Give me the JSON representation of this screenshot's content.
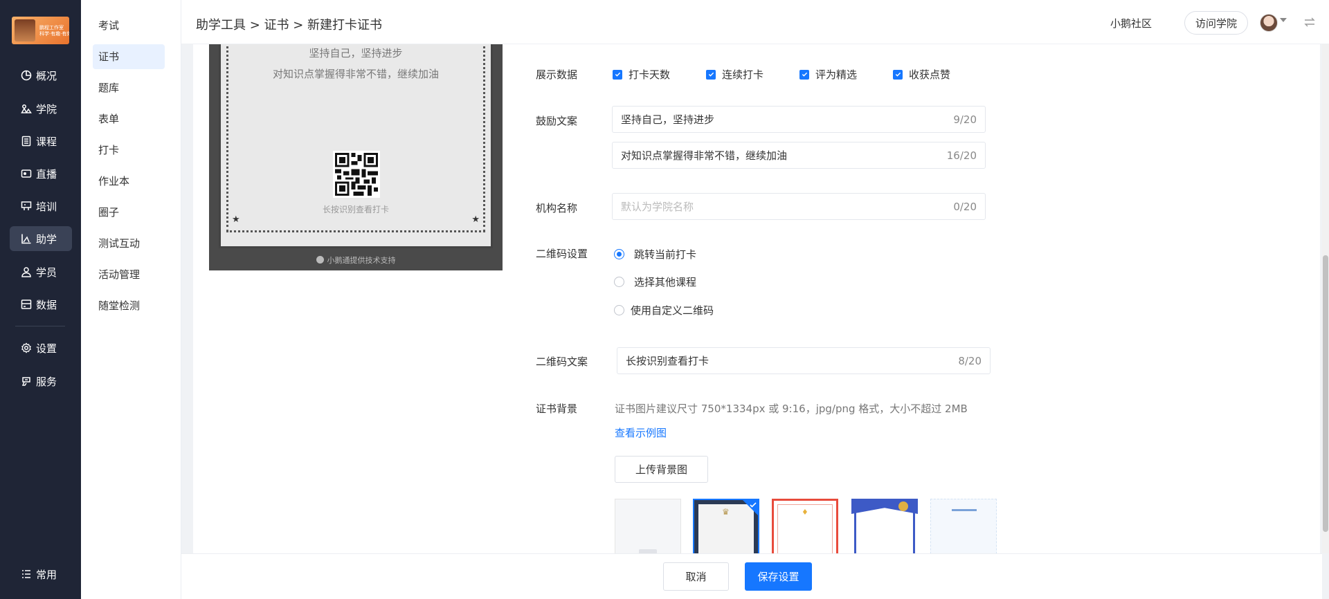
{
  "app": {
    "logo_text_line1": "鹏程工作室",
    "logo_text_line2": "科学·有趣·有效的成长"
  },
  "main_nav": [
    {
      "label": "概况",
      "icon": "pie-chart-icon"
    },
    {
      "label": "学院",
      "icon": "academy-icon"
    },
    {
      "label": "课程",
      "icon": "course-icon"
    },
    {
      "label": "直播",
      "icon": "live-icon"
    },
    {
      "label": "培训",
      "icon": "training-icon"
    },
    {
      "label": "助学",
      "icon": "study-aid-icon",
      "active": true
    },
    {
      "label": "学员",
      "icon": "user-icon"
    },
    {
      "label": "数据",
      "icon": "data-icon"
    },
    {
      "label": "设置",
      "icon": "gear-icon"
    },
    {
      "label": "服务",
      "icon": "service-icon"
    },
    {
      "label": "常用",
      "icon": "list-icon"
    }
  ],
  "sub_nav": [
    {
      "label": "考试"
    },
    {
      "label": "证书",
      "active": true
    },
    {
      "label": "题库"
    },
    {
      "label": "表单"
    },
    {
      "label": "打卡"
    },
    {
      "label": "作业本"
    },
    {
      "label": "圈子"
    },
    {
      "label": "测试互动"
    },
    {
      "label": "活动管理"
    },
    {
      "label": "随堂检测"
    }
  ],
  "header": {
    "breadcrumb": "助学工具 > 证书 > 新建打卡证书",
    "community": "小鹅社区",
    "visit_button": "访问学院"
  },
  "preview": {
    "line1": "坚持自己，坚持进步",
    "line2": "对知识点掌握得非常不错，继续加油",
    "qr_text": "长按识别查看打卡",
    "footer": "小鹅通提供技术支持"
  },
  "form": {
    "display_label": "展示数据",
    "display_options": [
      "打卡天数",
      "连续打卡",
      "评为精选",
      "收获点赞"
    ],
    "encourage_label": "鼓励文案",
    "encourage_1": {
      "value": "坚持自己，坚持进步",
      "count": "9/20"
    },
    "encourage_2": {
      "value": "对知识点掌握得非常不错，继续加油",
      "count": "16/20"
    },
    "org_label": "机构名称",
    "org": {
      "placeholder": "默认为学院名称",
      "count": "0/20"
    },
    "qr_label": "二维码设置",
    "qr_options": [
      {
        "label": "跳转当前打卡",
        "selected": true
      },
      {
        "label": "选择其他课程",
        "selected": false
      },
      {
        "label": "使用自定义二维码",
        "selected": false
      }
    ],
    "qr_text_label": "二维码文案",
    "qr_text": {
      "value": "长按识别查看打卡",
      "count": "8/20"
    },
    "bg_label": "证书背景",
    "bg_hint": "证书图片建议尺寸 750*1334px 或 9:16，jpg/png 格式，大小不超过 2MB",
    "bg_link": "查看示例图",
    "upload_button": "上传背景图"
  },
  "footer": {
    "cancel": "取消",
    "save": "保存设置"
  },
  "colors": {
    "sidebar_bg": "#1f2536",
    "primary": "#1677ff"
  }
}
